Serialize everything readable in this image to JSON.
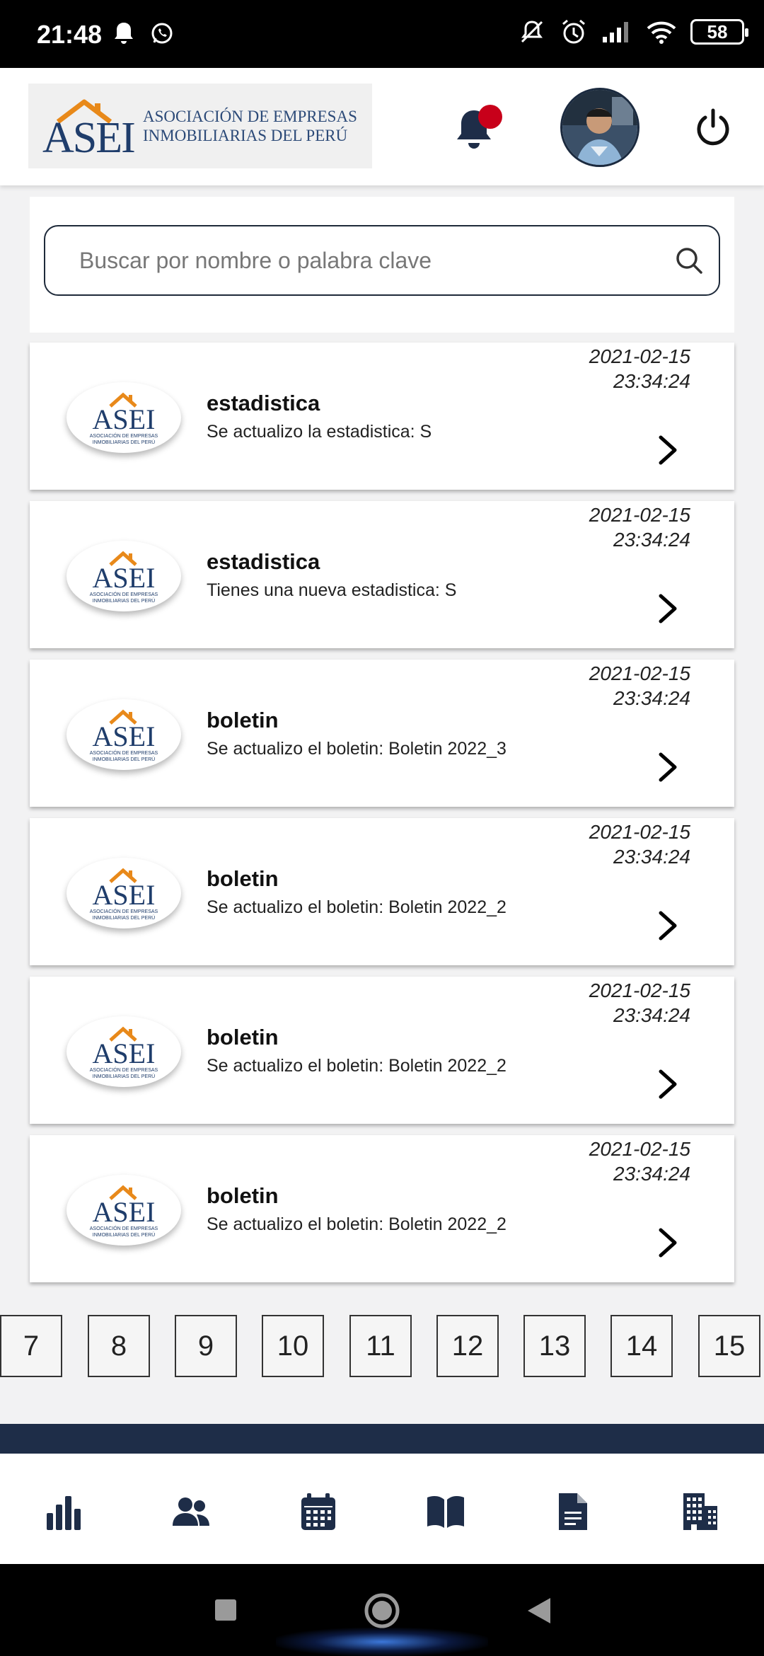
{
  "status_bar": {
    "time": "21:48",
    "battery": "58",
    "left_icons": [
      "bell-icon",
      "whatsapp-icon"
    ],
    "right_icons": [
      "mute-vibrate-icon",
      "alarm-icon",
      "signal-icon",
      "wifi-icon",
      "battery-icon"
    ]
  },
  "header": {
    "logo_mark": "ASEI",
    "logo_line1": "ASOCIACIÓN DE EMPRESAS",
    "logo_line2": "INMOBILIARIAS DEL PERÚ",
    "icons": [
      "bell-icon",
      "avatar",
      "power-icon"
    ]
  },
  "search": {
    "placeholder": "Buscar por nombre o palabra clave"
  },
  "notifications": [
    {
      "title": "estadistica",
      "description": "Se actualizo la estadistica: S",
      "date": "2021-02-15",
      "time": "23:34:24"
    },
    {
      "title": "estadistica",
      "description": "Tienes una nueva estadistica: S",
      "date": "2021-02-15",
      "time": "23:34:24"
    },
    {
      "title": "boletin",
      "description": "Se actualizo el boletin: Boletin 2022_3",
      "date": "2021-02-15",
      "time": "23:34:24"
    },
    {
      "title": "boletin",
      "description": "Se actualizo el boletin: Boletin 2022_2",
      "date": "2021-02-15",
      "time": "23:34:24"
    },
    {
      "title": "boletin",
      "description": "Se actualizo el boletin: Boletin 2022_2",
      "date": "2021-02-15",
      "time": "23:34:24"
    },
    {
      "title": "boletin",
      "description": "Se actualizo el boletin: Boletin 2022_2",
      "date": "2021-02-15",
      "time": "23:34:24"
    }
  ],
  "notif_logo_text": "ASEI",
  "notif_logo_sub1": "ASOCIACIÓN DE EMPRESAS",
  "notif_logo_sub2": "INMOBILIARIAS DEL PERÚ",
  "pagination": [
    "7",
    "8",
    "9",
    "10",
    "11",
    "12",
    "13",
    "14",
    "15"
  ],
  "bottom_nav": [
    "chart-icon",
    "users-icon",
    "calendar-icon",
    "book-icon",
    "document-icon",
    "building-icon"
  ],
  "colors": {
    "brand_navy": "#1e2d48",
    "brand_orange": "#e8891a",
    "notification_dot": "#c8001a"
  }
}
